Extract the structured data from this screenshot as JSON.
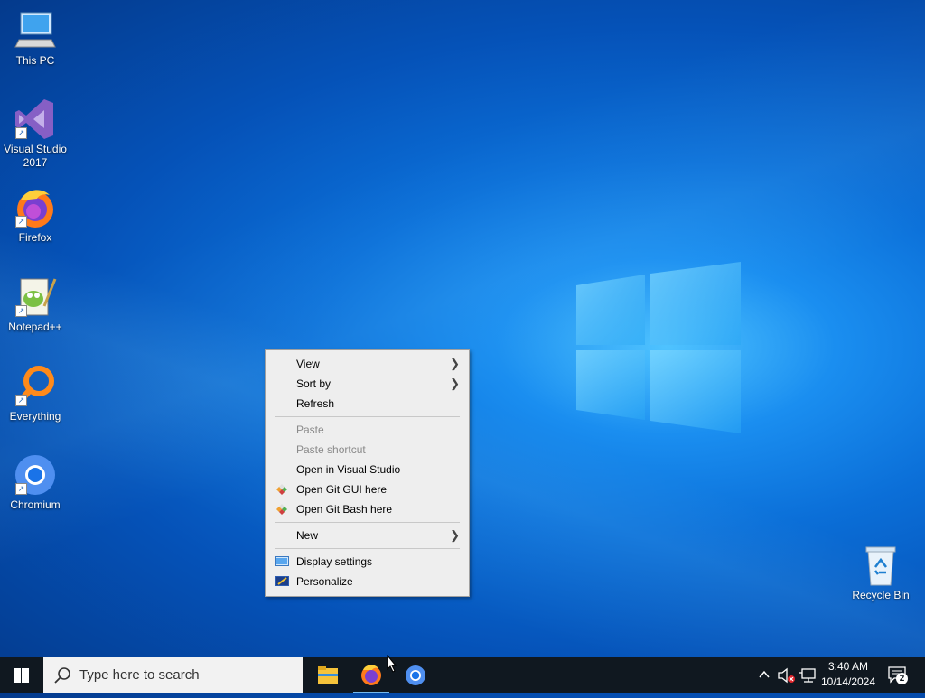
{
  "desktop": {
    "icons": [
      {
        "label": "This PC"
      },
      {
        "label": "Visual Studio 2017"
      },
      {
        "label": "Firefox"
      },
      {
        "label": "Notepad++"
      },
      {
        "label": "Everything"
      },
      {
        "label": "Chromium"
      },
      {
        "label": "Recycle Bin"
      }
    ]
  },
  "context_menu": {
    "items": [
      {
        "label": "View",
        "submenu": true
      },
      {
        "label": "Sort by",
        "submenu": true
      },
      {
        "label": "Refresh"
      },
      {
        "label": "Paste",
        "disabled": true
      },
      {
        "label": "Paste shortcut",
        "disabled": true
      },
      {
        "label": "Open in Visual Studio"
      },
      {
        "label": "Open Git GUI here",
        "icon": "git-icon"
      },
      {
        "label": "Open Git Bash here",
        "icon": "git-icon"
      },
      {
        "label": "New",
        "submenu": true
      },
      {
        "label": "Display settings",
        "icon": "display-icon"
      },
      {
        "label": "Personalize",
        "icon": "personalize-icon"
      }
    ]
  },
  "taskbar": {
    "search_placeholder": "Type here to search",
    "pinned": [
      "file-explorer-icon",
      "firefox-icon",
      "chromium-icon"
    ],
    "clock": {
      "time": "3:40 AM",
      "date": "10/14/2024"
    },
    "notification_count": "2"
  },
  "colors": {
    "taskbar": "#101820",
    "menu_bg": "#eeeeee",
    "accent": "#76b9ed"
  }
}
